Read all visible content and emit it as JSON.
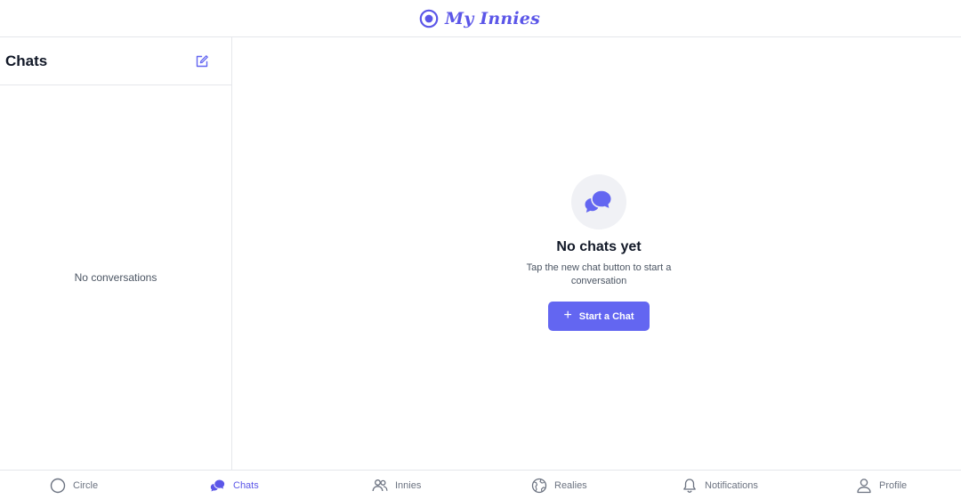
{
  "app": {
    "brand": "My Innies",
    "accent_color": "#6366f1"
  },
  "sidebar": {
    "title": "Chats",
    "new_chat_icon": "compose-icon",
    "empty_text": "No conversations"
  },
  "main": {
    "empty_icon": "chat-bubbles-icon",
    "empty_title": "No chats yet",
    "empty_subtitle": "Tap the new chat button to start a conversation",
    "start_button": {
      "icon": "plus-icon",
      "label": "Start a Chat"
    }
  },
  "bottom_nav": {
    "active": "Chats",
    "items": [
      {
        "label": "Circle",
        "icon": "circle-icon"
      },
      {
        "label": "Chats",
        "icon": "chat-bubbles-icon"
      },
      {
        "label": "Innies",
        "icon": "users-icon"
      },
      {
        "label": "Realies",
        "icon": "globe-icon"
      },
      {
        "label": "Notifications",
        "icon": "bell-icon"
      },
      {
        "label": "Profile",
        "icon": "user-icon"
      }
    ]
  }
}
